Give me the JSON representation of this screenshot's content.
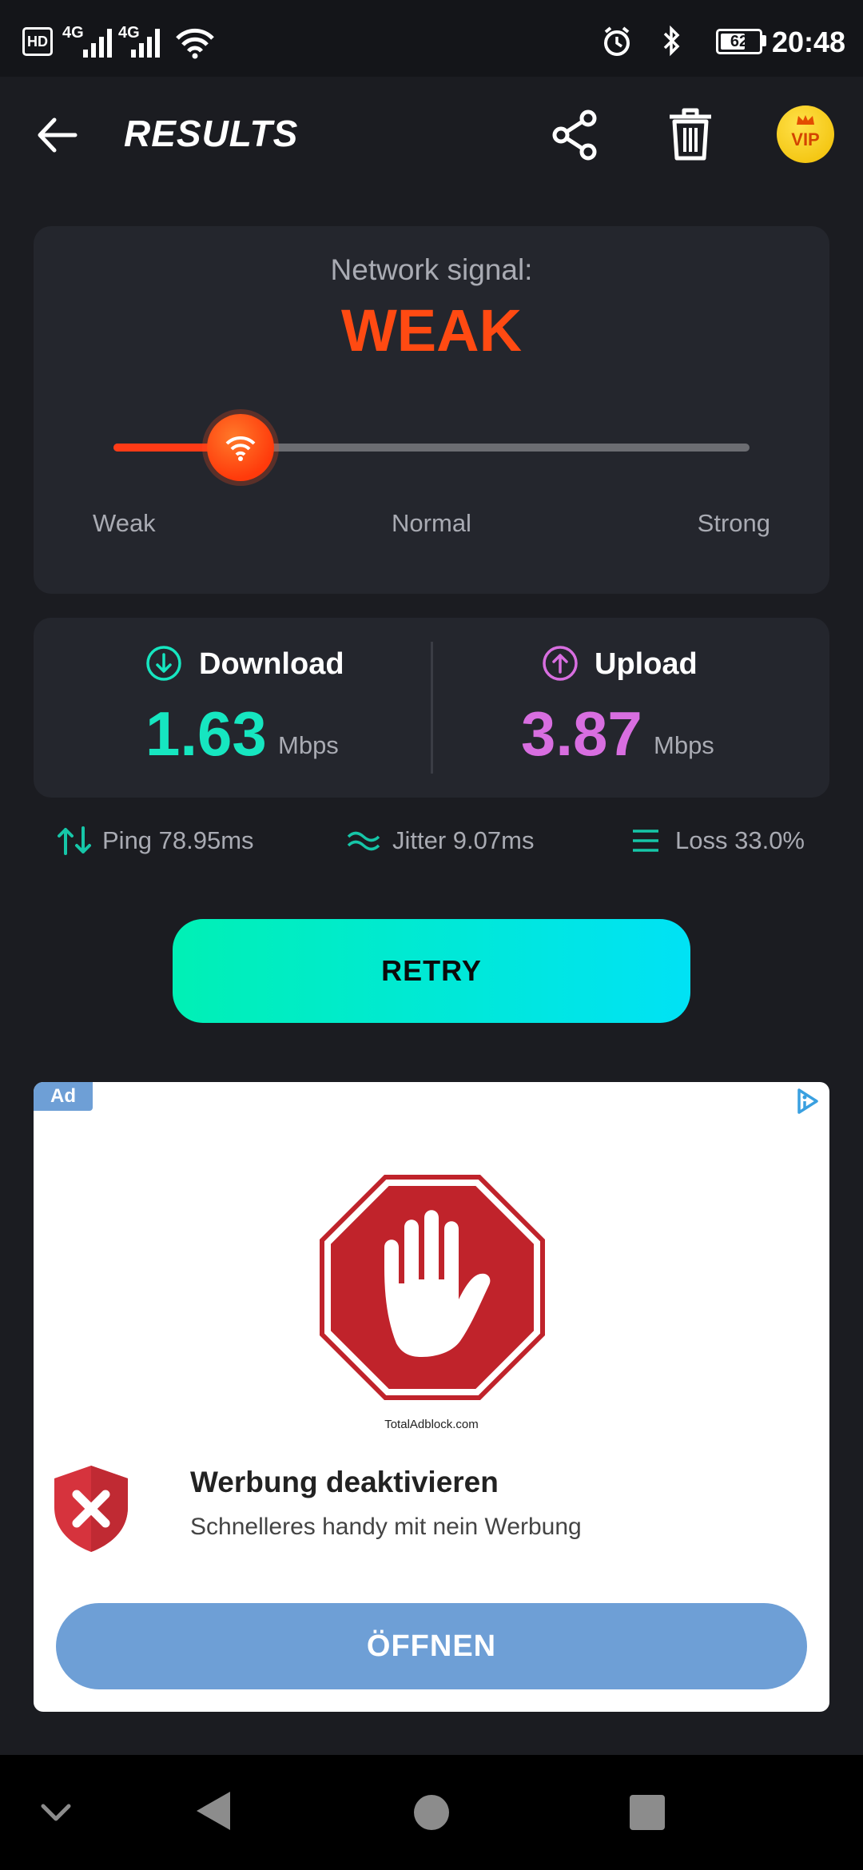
{
  "status_bar": {
    "hd": "HD",
    "net1": "4G",
    "net2": "4G",
    "battery": "62",
    "time": "20:48"
  },
  "header": {
    "title": "RESULTS"
  },
  "signal": {
    "label": "Network signal:",
    "value": "WEAK",
    "level": 0.2,
    "scale": [
      "Weak",
      "Normal",
      "Strong"
    ]
  },
  "speed": {
    "download": {
      "label": "Download",
      "value": "1.63",
      "unit": "Mbps"
    },
    "upload": {
      "label": "Upload",
      "value": "3.87",
      "unit": "Mbps"
    }
  },
  "metrics": {
    "ping": "Ping 78.95ms",
    "jitter": "Jitter 9.07ms",
    "loss": "Loss 33.0%"
  },
  "retry_label": "RETRY",
  "vip_label": "VIP",
  "ad": {
    "badge": "Ad",
    "image_caption": "TotalAdblock.com",
    "title": "Werbung deaktivieren",
    "subtitle": "Schnelleres handy mit nein Werbung",
    "cta": "ÖFFNEN"
  },
  "colors": {
    "accent_weak": "#ff4a12",
    "download": "#16e6c0",
    "upload": "#d86ee0",
    "retry_gradient": [
      "#00f0b5",
      "#00e2f5"
    ]
  }
}
